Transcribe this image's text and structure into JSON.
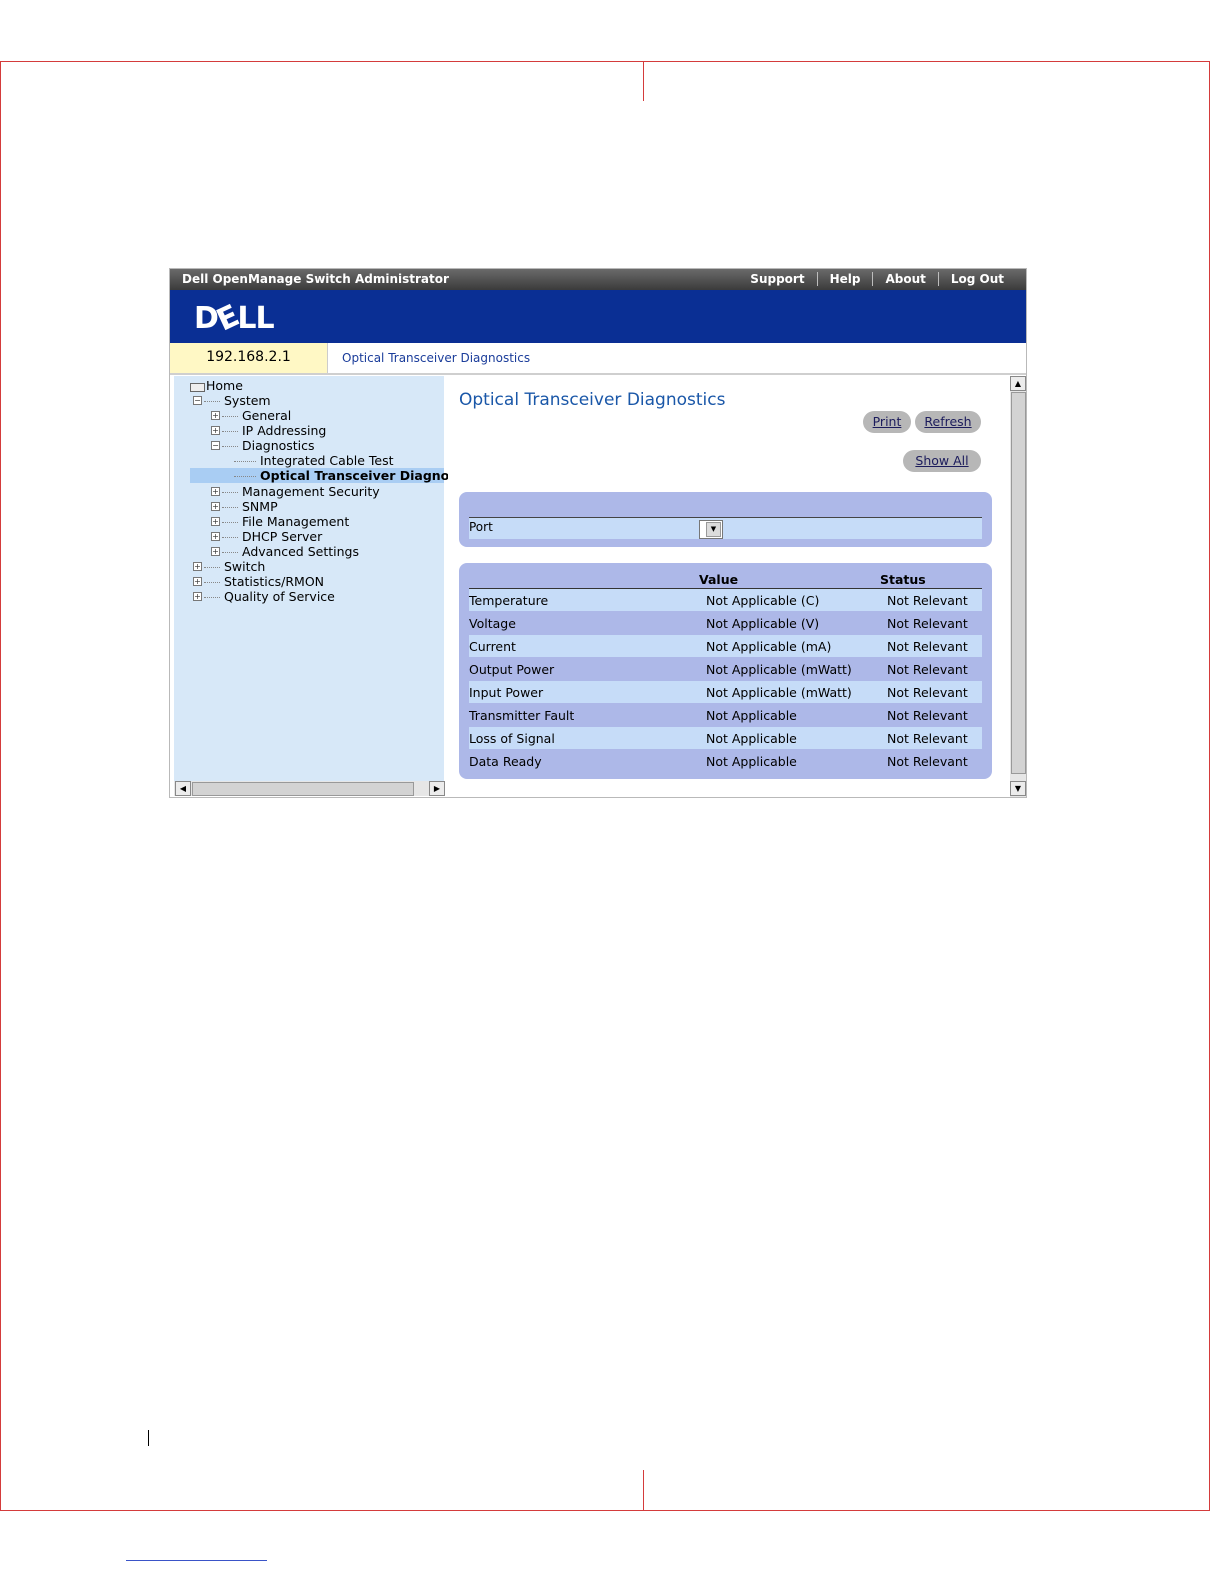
{
  "topbar": {
    "app_title": "Dell OpenManage Switch Administrator",
    "links": [
      "Support",
      "Help",
      "About",
      "Log Out"
    ]
  },
  "banner": {
    "logo_text": "DELL"
  },
  "address": {
    "ip": "192.168.2.1",
    "breadcrumb": "Optical Transceiver Diagnostics"
  },
  "tree": {
    "home": "Home",
    "system": "System",
    "general": "General",
    "ip_addressing": "IP Addressing",
    "diagnostics": "Diagnostics",
    "integrated_cable_test": "Integrated Cable Test",
    "optical_transceiver": "Optical Transceiver Diagnostic",
    "management_security": "Management Security",
    "snmp": "SNMP",
    "file_management": "File Management",
    "dhcp_server": "DHCP Server",
    "advanced_settings": "Advanced Settings",
    "switch": "Switch",
    "statistics_rmon": "Statistics/RMON",
    "quality_of_service": "Quality of Service"
  },
  "main": {
    "title": "Optical Transceiver Diagnostics",
    "print_label": "Print",
    "refresh_label": "Refresh",
    "show_all_label": "Show All",
    "port_label": "Port",
    "port_value": ""
  },
  "table": {
    "headers": [
      "",
      "Value",
      "Status"
    ],
    "rows": [
      [
        "Temperature",
        "Not Applicable (C)",
        "Not Relevant"
      ],
      [
        "Voltage",
        "Not Applicable (V)",
        "Not Relevant"
      ],
      [
        "Current",
        "Not Applicable (mA)",
        "Not Relevant"
      ],
      [
        "Output Power",
        "Not Applicable (mWatt)",
        "Not Relevant"
      ],
      [
        "Input Power",
        "Not Applicable (mWatt)",
        "Not Relevant"
      ],
      [
        "Transmitter Fault",
        "Not Applicable",
        "Not Relevant"
      ],
      [
        "Loss of Signal",
        "Not Applicable",
        "Not Relevant"
      ],
      [
        "Data Ready",
        "Not Applicable",
        "Not Relevant"
      ]
    ]
  }
}
